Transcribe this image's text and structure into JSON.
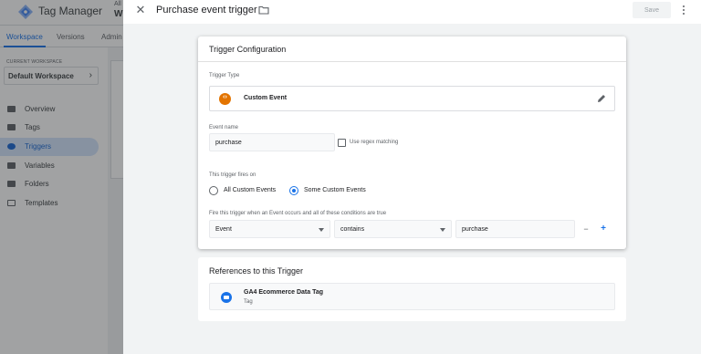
{
  "app": {
    "title": "Tag Manager",
    "account_prefix": "All",
    "container_initial": "W"
  },
  "top_tabs": [
    {
      "label": "Workspace",
      "active": true
    },
    {
      "label": "Versions",
      "active": false
    },
    {
      "label": "Admin",
      "active": false
    }
  ],
  "sidebar": {
    "current_workspace_label": "CURRENT WORKSPACE",
    "workspace_name": "Default Workspace",
    "items": [
      {
        "label": "Overview",
        "icon": "folder-icon",
        "active": false
      },
      {
        "label": "Tags",
        "icon": "tag-icon",
        "active": false
      },
      {
        "label": "Triggers",
        "icon": "trigger-icon",
        "active": true
      },
      {
        "label": "Variables",
        "icon": "variables-icon",
        "active": false
      },
      {
        "label": "Folders",
        "icon": "folder-icon",
        "active": false
      },
      {
        "label": "Templates",
        "icon": "template-icon",
        "active": false
      }
    ]
  },
  "panel": {
    "title": "Purchase event trigger",
    "save_label": "Save"
  },
  "trigger_config": {
    "heading": "Trigger Configuration",
    "trigger_type_label": "Trigger Type",
    "trigger_type_name": "Custom Event",
    "event_name_label": "Event name",
    "event_name_value": "purchase",
    "regex_label": "Use regex matching",
    "regex_checked": false,
    "fires_on_label": "This trigger fires on",
    "fires_on_options": [
      {
        "label": "All Custom Events",
        "checked": false
      },
      {
        "label": "Some Custom Events",
        "checked": true
      }
    ],
    "condition_label": "Fire this trigger when an Event occurs and all of these conditions are true",
    "condition": {
      "variable": "Event",
      "operator": "contains",
      "value": "purchase"
    },
    "remove_label": "−",
    "add_label": "+"
  },
  "references": {
    "heading": "References to this Trigger",
    "items": [
      {
        "name": "GA4 Ecommerce Data Tag",
        "type": "Tag"
      }
    ]
  },
  "colors": {
    "accent": "#1a73e8",
    "custom_event_icon": "#e37400"
  }
}
